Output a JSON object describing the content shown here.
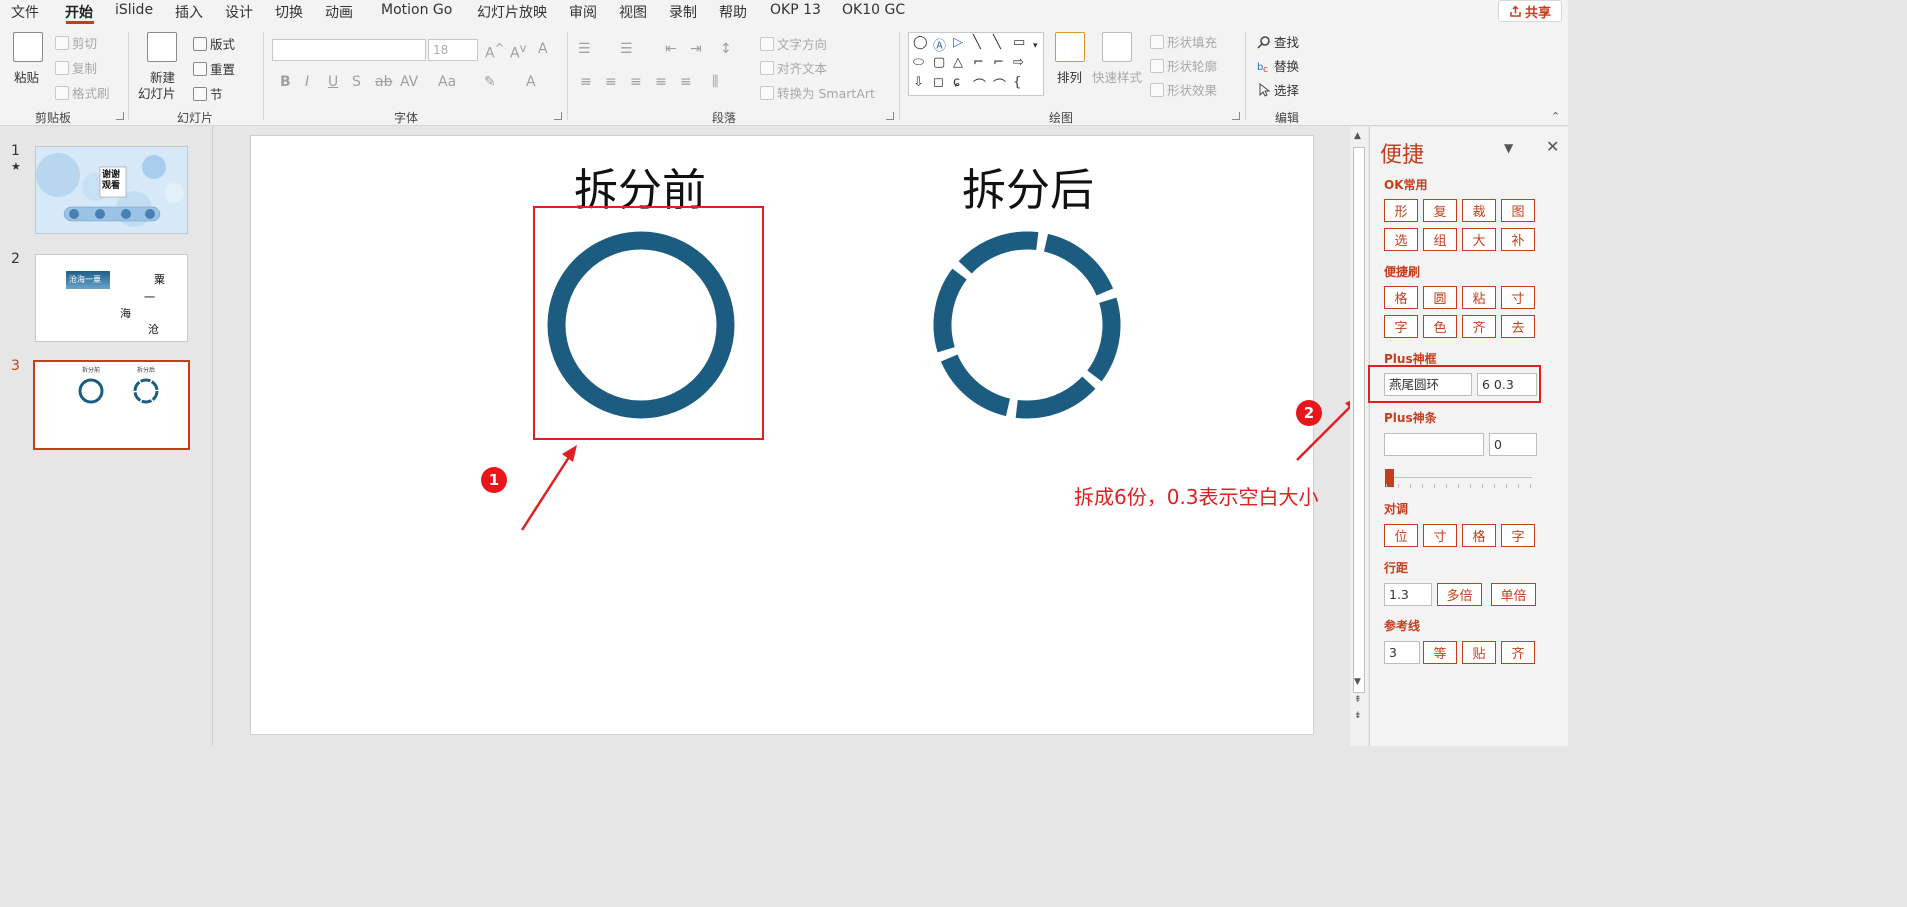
{
  "menu": {
    "items": [
      "文件",
      "开始",
      "iSlide",
      "插入",
      "设计",
      "切换",
      "动画",
      "Motion Go",
      "幻灯片放映",
      "审阅",
      "视图",
      "录制",
      "帮助",
      "OKP 13",
      "OK10 GC"
    ],
    "active": "开始",
    "share": "共享"
  },
  "ribbon": {
    "clipboard": {
      "paste": "粘贴",
      "cut": "剪切",
      "copy": "复制",
      "format_painter": "格式刷",
      "label": "剪贴板"
    },
    "slides": {
      "new_slide": "新建",
      "new_slide_2": "幻灯片",
      "layout": "版式",
      "reset": "重置",
      "section": "节",
      "label": "幻灯片"
    },
    "font": {
      "font_size": "18",
      "label": "字体"
    },
    "paragraph": {
      "text_direction": "文字方向",
      "align_text": "对齐文本",
      "convert_smartart": "转换为 SmartArt",
      "label": "段落"
    },
    "drawing": {
      "arrange": "排列",
      "quick_styles": "快速样式",
      "shape_fill": "形状填充",
      "shape_outline": "形状轮廓",
      "shape_effects": "形状效果",
      "label": "绘图"
    },
    "editing": {
      "find": "查找",
      "replace": "替换",
      "select": "选择",
      "label": "编辑"
    }
  },
  "slides": [
    {
      "number": "1",
      "star": "★",
      "text": "谢谢观看"
    },
    {
      "number": "2",
      "title": "沧海一粟",
      "chars": [
        "粟",
        "一",
        "海",
        "沧"
      ]
    },
    {
      "number": "3",
      "left_label": "拆分前",
      "right_label": "拆分后"
    }
  ],
  "slide": {
    "title_left": "拆分前",
    "title_right": "拆分后",
    "ring_color": "#1b5c80",
    "badge1": "1",
    "badge2": "2",
    "annotation": "拆成6份，0.3表示空白大小"
  },
  "pane": {
    "title": "便捷",
    "ok_common": {
      "label": "OK常用",
      "buttons": [
        "形",
        "复",
        "裁",
        "图",
        "选",
        "组",
        "大",
        "补"
      ]
    },
    "brush": {
      "label": "便捷刷",
      "buttons": [
        "格",
        "圆",
        "粘",
        "寸",
        "字",
        "色",
        "齐",
        "去"
      ]
    },
    "plus_box": {
      "label": "Plus神框",
      "shape": "燕尾圆环",
      "params": "6 0.3"
    },
    "plus_bar": {
      "label": "Plus神条",
      "value": "0"
    },
    "align": {
      "label": "对调",
      "buttons": [
        "位",
        "寸",
        "格",
        "字"
      ]
    },
    "line_spacing": {
      "label": "行距",
      "value": "1.3",
      "multi": "多倍",
      "single": "单倍"
    },
    "guides": {
      "label": "参考线",
      "value": "3",
      "buttons": [
        "等",
        "贴",
        "齐"
      ]
    }
  }
}
